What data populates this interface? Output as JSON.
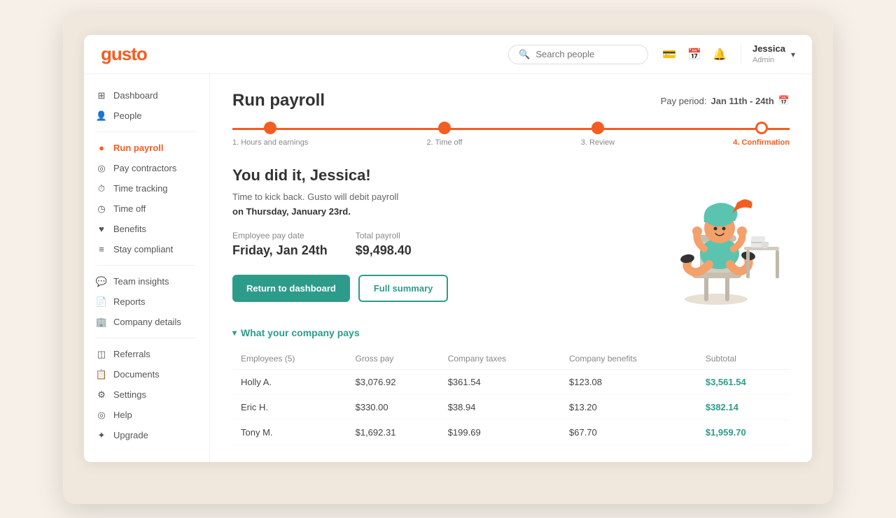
{
  "logo": "gusto",
  "header": {
    "search_placeholder": "Search people",
    "user_name": "Jessica",
    "user_role": "Admin"
  },
  "sidebar": {
    "items": [
      {
        "id": "dashboard",
        "label": "Dashboard",
        "icon": "⊞",
        "active": false
      },
      {
        "id": "people",
        "label": "People",
        "icon": "👤",
        "active": false
      },
      {
        "id": "run-payroll",
        "label": "Run payroll",
        "icon": "●",
        "active": true
      },
      {
        "id": "pay-contractors",
        "label": "Pay contractors",
        "icon": "◎",
        "active": false
      },
      {
        "id": "time-tracking",
        "label": "Time tracking",
        "icon": "⏱",
        "active": false
      },
      {
        "id": "time-off",
        "label": "Time off",
        "icon": "◷",
        "active": false
      },
      {
        "id": "benefits",
        "label": "Benefits",
        "icon": "♥",
        "active": false
      },
      {
        "id": "stay-compliant",
        "label": "Stay compliant",
        "icon": "≡",
        "active": false
      },
      {
        "id": "team-insights",
        "label": "Team insights",
        "icon": "💬",
        "active": false
      },
      {
        "id": "reports",
        "label": "Reports",
        "icon": "📄",
        "active": false
      },
      {
        "id": "company-details",
        "label": "Company details",
        "icon": "🏢",
        "active": false
      },
      {
        "id": "referrals",
        "label": "Referrals",
        "icon": "◫",
        "active": false
      },
      {
        "id": "documents",
        "label": "Documents",
        "icon": "📋",
        "active": false
      },
      {
        "id": "settings",
        "label": "Settings",
        "icon": "⚙",
        "active": false
      },
      {
        "id": "help",
        "label": "Help",
        "icon": "◎",
        "active": false
      },
      {
        "id": "upgrade",
        "label": "Upgrade",
        "icon": "✦",
        "active": false
      }
    ]
  },
  "page": {
    "title": "Run payroll",
    "pay_period_label": "Pay period:",
    "pay_period_value": "Jan 11th - 24th",
    "steps": [
      {
        "label": "1. Hours and earnings",
        "completed": true,
        "active": false
      },
      {
        "label": "2. Time off",
        "completed": true,
        "active": false
      },
      {
        "label": "3. Review",
        "completed": true,
        "active": false
      },
      {
        "label": "4. Confirmation",
        "completed": true,
        "active": true
      }
    ],
    "success": {
      "title": "You did it, Jessica!",
      "subtitle_1": "Time to kick back. Gusto will debit payroll",
      "subtitle_2": "on Thursday, January 23rd.",
      "pay_date_label": "Employee pay date",
      "pay_date_value": "Friday, Jan 24th",
      "total_label": "Total payroll",
      "total_value": "$9,498.40",
      "btn_dashboard": "Return to dashboard",
      "btn_summary": "Full summary"
    },
    "table_section": {
      "toggle_label": "What your company pays",
      "columns": [
        "Employees (5)",
        "Gross pay",
        "Company taxes",
        "Company benefits",
        "Subtotal"
      ],
      "rows": [
        {
          "name": "Holly A.",
          "gross": "$3,076.92",
          "taxes": "$361.54",
          "benefits": "$123.08",
          "subtotal": "$3,561.54"
        },
        {
          "name": "Eric H.",
          "gross": "$330.00",
          "taxes": "$38.94",
          "benefits": "$13.20",
          "subtotal": "$382.14"
        },
        {
          "name": "Tony M.",
          "gross": "$1,692.31",
          "taxes": "$199.69",
          "benefits": "$67.70",
          "subtotal": "$1,959.70"
        }
      ]
    }
  },
  "colors": {
    "brand_orange": "#f45d22",
    "brand_teal": "#2d9b8a",
    "active_nav": "#f45d22"
  }
}
